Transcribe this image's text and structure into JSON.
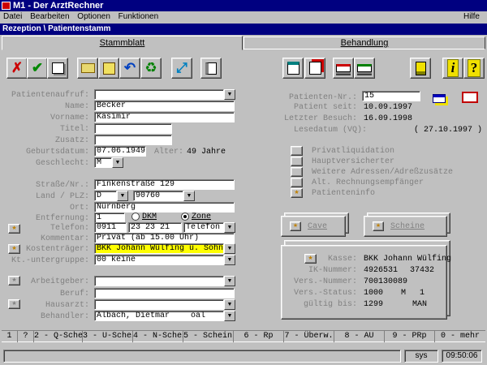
{
  "window": {
    "title": "M1 - Der ArztRechner"
  },
  "menu": {
    "items": [
      "Datei",
      "Bearbeiten",
      "Optionen",
      "Funktionen"
    ],
    "help": "Hilfe"
  },
  "subwindow": {
    "title": "Rezeption \\ Patientenstamm"
  },
  "tabs": {
    "active": "Stammblatt",
    "other": "Behandlung"
  },
  "toolbar": {
    "icons": [
      "cancel-icon",
      "confirm-icon",
      "print-form-icon",
      "open-folder-icon",
      "edit-document-icon",
      "undo-icon",
      "recycle-icon",
      "fullscreen-icon",
      "list-view-icon",
      "calendar-icon",
      "copy-record-icon",
      "stack-import-icon",
      "stack-export-icon",
      "notes-icon",
      "info-icon",
      "help-icon"
    ],
    "info_label": "i",
    "help_label": "?"
  },
  "left": {
    "patientenaufruf": {
      "label": "Patientenaufruf:",
      "value": ""
    },
    "name": {
      "label": "Name:",
      "value": "Becker"
    },
    "vorname": {
      "label": "Vorname:",
      "value": "Kasimir"
    },
    "titel": {
      "label": "Titel:",
      "value": ""
    },
    "zusatz": {
      "label": "Zusatz:",
      "value": ""
    },
    "geburtsdatum": {
      "label": "Geburtsdatum:",
      "value": "07.06.1949"
    },
    "alter": {
      "label": "Alter:",
      "value": "49 Jahre"
    },
    "geschlecht": {
      "label": "Geschlecht:",
      "value": "M"
    },
    "strasse": {
      "label": "Straße/Nr.:",
      "value": "Finkenstraße 129"
    },
    "land_plz": {
      "label": "Land / PLZ:",
      "land": "D",
      "plz": "90760"
    },
    "ort": {
      "label": "Ort:",
      "value": "Nürnberg"
    },
    "entfernung": {
      "label": "Entfernung:",
      "value": "1",
      "option1": "DKM",
      "option2": "Zone"
    },
    "telefon": {
      "label": "Telefon:",
      "vorwahl": "0911",
      "nummer": "23 23 21",
      "typ": "Telefon"
    },
    "kommentar": {
      "label": "Kommentar:",
      "value": "Privat (ab 15.00 Uhr)"
    },
    "kostentraeger": {
      "label": "Kostenträger:",
      "value": "BKK Johann Wülfing u. Sohn"
    },
    "untergruppe": {
      "label": "Kt.-untergruppe:",
      "value": "00 keine"
    },
    "arbeitgeber": {
      "label": "Arbeitgeber:",
      "value": ""
    },
    "beruf": {
      "label": "Beruf:",
      "value": ""
    },
    "hausarzt": {
      "label": "Hausarzt:",
      "value": ""
    },
    "behandler": {
      "label": "Behandler:",
      "name": "Albach, Dietmar",
      "code": "oal"
    }
  },
  "right": {
    "patnr": {
      "label": "Patienten-Nr.:",
      "value": "15"
    },
    "seit": {
      "label": "Patient seit:",
      "value": "10.09.1997"
    },
    "besuch": {
      "label": "Letzter Besuch:",
      "value": "16.09.1998"
    },
    "lesedatum": {
      "label": "Lesedatum (VQ):",
      "value": "( 27.10.1997 )"
    },
    "options": [
      "Privatliquidation",
      "Hauptversicherter",
      "Weitere Adressen/Adreßzusätze",
      "Alt. Rechnungsempfänger",
      "Patienteninfo"
    ],
    "cave": "Cave",
    "scheine": "Scheine",
    "kasse": {
      "label": "Kasse:",
      "value": "BKK Johann Wülfing"
    },
    "ik": {
      "label": "IK-Nummer:",
      "value": "4926531",
      "extra": "37432"
    },
    "versnr": {
      "label": "Vers.-Nummer:",
      "value": "700130089"
    },
    "versstatus": {
      "label": "Vers.-Status:",
      "value": "1000",
      "m": "M",
      "n": "1"
    },
    "gueltig": {
      "label": "gültig bis:",
      "value": "1299",
      "extra": "MAN"
    }
  },
  "fkeys": [
    "1",
    "?",
    "2 - Q-Schein",
    "3 - U-Schein",
    "4 - N-Schein",
    "5 - Scheins",
    "6 - Rp",
    "7 - Überw.",
    "8 - AU",
    "9 - PRp",
    "0 - mehr"
  ],
  "status": {
    "user": "sys",
    "time": "09:50:06"
  },
  "colors": {
    "titlebar": "#000080",
    "highlight": "#ffff00",
    "face": "#c0c0c0"
  }
}
